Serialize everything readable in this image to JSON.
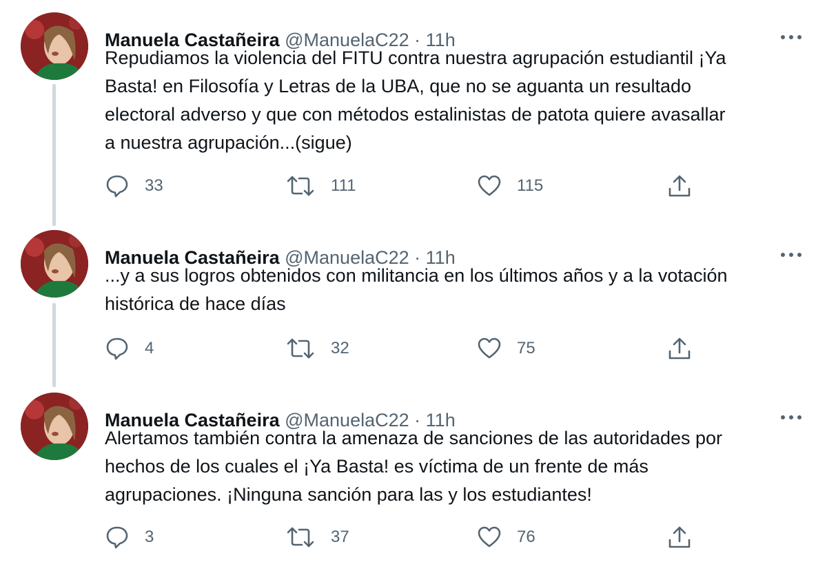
{
  "tweets": [
    {
      "author": "Manuela Castañeira",
      "handle": "@ManuelaC22",
      "separator": "·",
      "time": "11h",
      "text": "Repudiamos la violencia del FITU contra nuestra agrupación estudiantil ¡Ya\nBasta! en Filosofía y Letras de la UBA, que no se aguanta un resultado\nelectoral adverso y que con métodos estalinistas de patota quiere avasallar\na nuestra agrupación...(sigue)",
      "replies": "33",
      "retweets": "111",
      "likes": "115"
    },
    {
      "author": "Manuela Castañeira",
      "handle": "@ManuelaC22",
      "separator": "·",
      "time": "11h",
      "text": "...y a sus logros obtenidos con militancia en los últimos años y a la votación\nhistórica de hace días",
      "replies": "4",
      "retweets": "32",
      "likes": "75"
    },
    {
      "author": "Manuela Castañeira",
      "handle": "@ManuelaC22",
      "separator": "·",
      "time": "11h",
      "text": "Alertamos también contra la amenaza de sanciones de las autoridades  por\nhechos de los cuales el ¡Ya Basta! es víctima de un frente de más\nagrupaciones. ¡Ninguna sanción para las y los estudiantes!",
      "replies": "3",
      "retweets": "37",
      "likes": "76"
    }
  ],
  "icons": {
    "reply": "reply-icon",
    "retweet": "retweet-icon",
    "like": "like-icon",
    "share": "share-icon",
    "more": "more-options-icon"
  },
  "colors": {
    "text": "#0f1419",
    "secondary": "#536471",
    "thread_line": "#cfd9de"
  }
}
